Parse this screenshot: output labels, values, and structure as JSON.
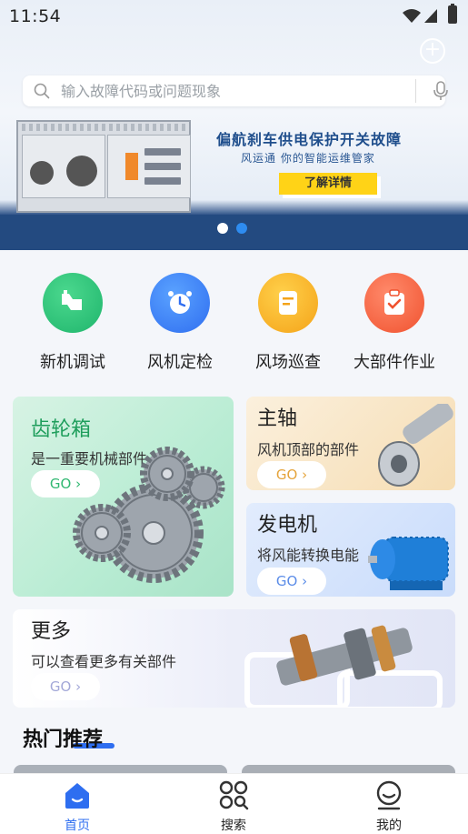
{
  "status_bar": {
    "time": "11:54"
  },
  "search": {
    "placeholder": "输入故障代码或问题现象"
  },
  "banner": {
    "title": "偏航刹车供电保护开关故障",
    "subtitle": "风运通 你的智能运维管家",
    "button_label": "了解详情",
    "pages": 2,
    "active_page": 1
  },
  "quick_menu": [
    {
      "label": "新机调试",
      "icon": "wrench-machine-icon",
      "color": "#1fb56c"
    },
    {
      "label": "风机定检",
      "icon": "alarm-clock-icon",
      "color": "#2f6ef0"
    },
    {
      "label": "风场巡查",
      "icon": "document-icon",
      "color": "#f4a319"
    },
    {
      "label": "大部件作业",
      "icon": "clipboard-check-icon",
      "color": "#f0522f"
    }
  ],
  "cards": {
    "gearbox": {
      "title": "齿轮箱",
      "desc": "是一重要机械部件",
      "go": "GO ›"
    },
    "spindle": {
      "title": "主轴",
      "desc": "风机顶部的部件",
      "go": "GO ›"
    },
    "generator": {
      "title": "发电机",
      "desc": "将风能转换电能",
      "go": "GO ›"
    },
    "more": {
      "title": "更多",
      "desc": "可以查看更多有关部件",
      "go": "GO ›"
    }
  },
  "section": {
    "title": "热门推荐"
  },
  "tabbar": [
    {
      "label": "首页",
      "icon": "home-icon",
      "active": true
    },
    {
      "label": "搜索",
      "icon": "search-grid-icon",
      "active": false
    },
    {
      "label": "我的",
      "icon": "profile-icon",
      "active": false
    }
  ],
  "colors": {
    "accent": "#2e6ef0",
    "banner_navy": "#234a80",
    "banner_button": "#ffd317"
  }
}
